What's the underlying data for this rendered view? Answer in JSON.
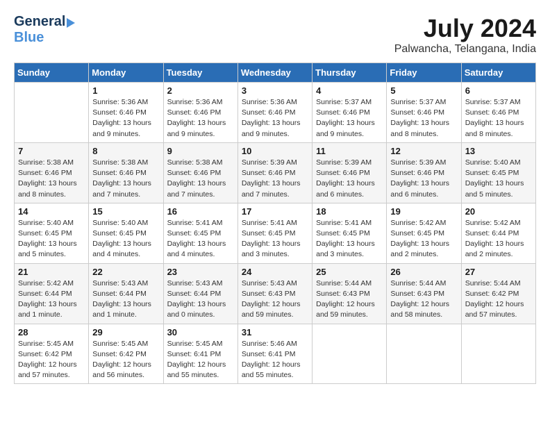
{
  "header": {
    "logo_general": "General",
    "logo_blue": "Blue",
    "month_year": "July 2024",
    "location": "Palwancha, Telangana, India"
  },
  "columns": [
    "Sunday",
    "Monday",
    "Tuesday",
    "Wednesday",
    "Thursday",
    "Friday",
    "Saturday"
  ],
  "weeks": [
    [
      {
        "day": "",
        "info": ""
      },
      {
        "day": "1",
        "info": "Sunrise: 5:36 AM\nSunset: 6:46 PM\nDaylight: 13 hours\nand 9 minutes."
      },
      {
        "day": "2",
        "info": "Sunrise: 5:36 AM\nSunset: 6:46 PM\nDaylight: 13 hours\nand 9 minutes."
      },
      {
        "day": "3",
        "info": "Sunrise: 5:36 AM\nSunset: 6:46 PM\nDaylight: 13 hours\nand 9 minutes."
      },
      {
        "day": "4",
        "info": "Sunrise: 5:37 AM\nSunset: 6:46 PM\nDaylight: 13 hours\nand 9 minutes."
      },
      {
        "day": "5",
        "info": "Sunrise: 5:37 AM\nSunset: 6:46 PM\nDaylight: 13 hours\nand 8 minutes."
      },
      {
        "day": "6",
        "info": "Sunrise: 5:37 AM\nSunset: 6:46 PM\nDaylight: 13 hours\nand 8 minutes."
      }
    ],
    [
      {
        "day": "7",
        "info": "Sunrise: 5:38 AM\nSunset: 6:46 PM\nDaylight: 13 hours\nand 8 minutes."
      },
      {
        "day": "8",
        "info": "Sunrise: 5:38 AM\nSunset: 6:46 PM\nDaylight: 13 hours\nand 7 minutes."
      },
      {
        "day": "9",
        "info": "Sunrise: 5:38 AM\nSunset: 6:46 PM\nDaylight: 13 hours\nand 7 minutes."
      },
      {
        "day": "10",
        "info": "Sunrise: 5:39 AM\nSunset: 6:46 PM\nDaylight: 13 hours\nand 7 minutes."
      },
      {
        "day": "11",
        "info": "Sunrise: 5:39 AM\nSunset: 6:46 PM\nDaylight: 13 hours\nand 6 minutes."
      },
      {
        "day": "12",
        "info": "Sunrise: 5:39 AM\nSunset: 6:46 PM\nDaylight: 13 hours\nand 6 minutes."
      },
      {
        "day": "13",
        "info": "Sunrise: 5:40 AM\nSunset: 6:45 PM\nDaylight: 13 hours\nand 5 minutes."
      }
    ],
    [
      {
        "day": "14",
        "info": "Sunrise: 5:40 AM\nSunset: 6:45 PM\nDaylight: 13 hours\nand 5 minutes."
      },
      {
        "day": "15",
        "info": "Sunrise: 5:40 AM\nSunset: 6:45 PM\nDaylight: 13 hours\nand 4 minutes."
      },
      {
        "day": "16",
        "info": "Sunrise: 5:41 AM\nSunset: 6:45 PM\nDaylight: 13 hours\nand 4 minutes."
      },
      {
        "day": "17",
        "info": "Sunrise: 5:41 AM\nSunset: 6:45 PM\nDaylight: 13 hours\nand 3 minutes."
      },
      {
        "day": "18",
        "info": "Sunrise: 5:41 AM\nSunset: 6:45 PM\nDaylight: 13 hours\nand 3 minutes."
      },
      {
        "day": "19",
        "info": "Sunrise: 5:42 AM\nSunset: 6:45 PM\nDaylight: 13 hours\nand 2 minutes."
      },
      {
        "day": "20",
        "info": "Sunrise: 5:42 AM\nSunset: 6:44 PM\nDaylight: 13 hours\nand 2 minutes."
      }
    ],
    [
      {
        "day": "21",
        "info": "Sunrise: 5:42 AM\nSunset: 6:44 PM\nDaylight: 13 hours\nand 1 minute."
      },
      {
        "day": "22",
        "info": "Sunrise: 5:43 AM\nSunset: 6:44 PM\nDaylight: 13 hours\nand 1 minute."
      },
      {
        "day": "23",
        "info": "Sunrise: 5:43 AM\nSunset: 6:44 PM\nDaylight: 13 hours\nand 0 minutes."
      },
      {
        "day": "24",
        "info": "Sunrise: 5:43 AM\nSunset: 6:43 PM\nDaylight: 12 hours\nand 59 minutes."
      },
      {
        "day": "25",
        "info": "Sunrise: 5:44 AM\nSunset: 6:43 PM\nDaylight: 12 hours\nand 59 minutes."
      },
      {
        "day": "26",
        "info": "Sunrise: 5:44 AM\nSunset: 6:43 PM\nDaylight: 12 hours\nand 58 minutes."
      },
      {
        "day": "27",
        "info": "Sunrise: 5:44 AM\nSunset: 6:42 PM\nDaylight: 12 hours\nand 57 minutes."
      }
    ],
    [
      {
        "day": "28",
        "info": "Sunrise: 5:45 AM\nSunset: 6:42 PM\nDaylight: 12 hours\nand 57 minutes."
      },
      {
        "day": "29",
        "info": "Sunrise: 5:45 AM\nSunset: 6:42 PM\nDaylight: 12 hours\nand 56 minutes."
      },
      {
        "day": "30",
        "info": "Sunrise: 5:45 AM\nSunset: 6:41 PM\nDaylight: 12 hours\nand 55 minutes."
      },
      {
        "day": "31",
        "info": "Sunrise: 5:46 AM\nSunset: 6:41 PM\nDaylight: 12 hours\nand 55 minutes."
      },
      {
        "day": "",
        "info": ""
      },
      {
        "day": "",
        "info": ""
      },
      {
        "day": "",
        "info": ""
      }
    ]
  ]
}
